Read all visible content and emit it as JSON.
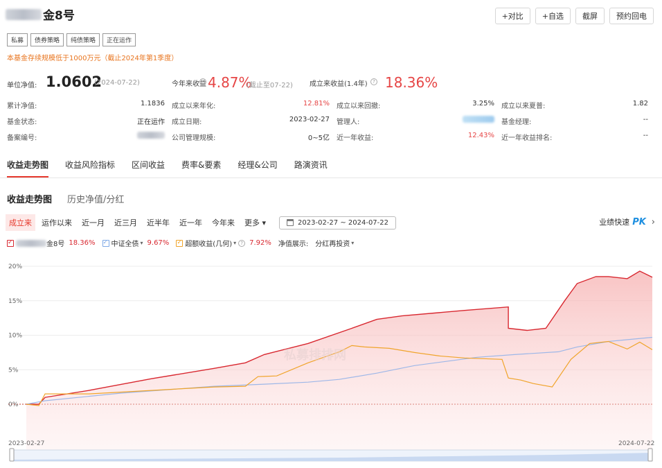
{
  "header": {
    "title_suffix": "金8号",
    "buttons": [
      "+对比",
      "+自选",
      "截屏",
      "预约回电"
    ]
  },
  "tags": [
    "私募",
    "债券策略",
    "纯债策略",
    "正在运作"
  ],
  "notice": "本基金存续规模低于1000万元（截止2024年第1季度）",
  "kpis": {
    "nav_label": "单位净值:",
    "nav_value": "1.0602",
    "nav_date": "(2024-07-22)",
    "ytd_label": "今年来收益",
    "ytd_value": "4.87%",
    "ytd_note": "(截止至07-22)",
    "since_label": "成立来收益(1.4年)",
    "since_value": "18.36%"
  },
  "info": [
    {
      "label": "累计净值:",
      "value": "1.1836",
      "red": false
    },
    {
      "label": "成立以来年化:",
      "value": "12.81%",
      "red": true
    },
    {
      "label": "成立以来回撤:",
      "value": "3.25%",
      "red": false
    },
    {
      "label": "成立以来夏普:",
      "value": "1.82",
      "red": false
    },
    {
      "label": "基金状态:",
      "value": "正在运作",
      "red": false
    },
    {
      "label": "成立日期:",
      "value": "2023-02-27",
      "red": false
    },
    {
      "label": "管理人:",
      "value": "",
      "red": false
    },
    {
      "label": "基金经理:",
      "value": "--",
      "red": false
    },
    {
      "label": "备案编号:",
      "value": "",
      "red": false
    },
    {
      "label": "公司管理规模:",
      "value": "0~5亿",
      "red": false
    },
    {
      "label": "近一年收益:",
      "value": "12.43%",
      "red": true
    },
    {
      "label": "近一年收益排名:",
      "value": "--",
      "red": false
    }
  ],
  "tabs": [
    "收益走势图",
    "收益风险指标",
    "区间收益",
    "费率&要素",
    "经理&公司",
    "路演资讯"
  ],
  "subtabs": [
    "收益走势图",
    "历史净值/分红"
  ],
  "periods": [
    "成立来",
    "运作以来",
    "近一月",
    "近三月",
    "近半年",
    "近一年",
    "今年来",
    "更多 ▾"
  ],
  "date_range": "2023-02-27 ~ 2024-07-22",
  "pk_label": "业绩快速",
  "pk_badge": "PK",
  "legend": {
    "fund_suffix": "金8号",
    "fund_value": "18.36%",
    "bench_name": "中证全债",
    "bench_value": "9.67%",
    "excess_name": "超额收益(几何)",
    "excess_value": "7.92%",
    "display_label": "净值展示:",
    "display_value": "分红再投资"
  },
  "colors": {
    "fund": "#d8272f",
    "bench": "#9db7e8",
    "excess": "#f0a42a",
    "accent": "#e6392d"
  },
  "chart_data": {
    "type": "line",
    "x_start": "2023-02-27",
    "x_end": "2024-07-22",
    "y_ticks": [
      "20%",
      "15%",
      "10%",
      "5%",
      "0%"
    ],
    "ylim": [
      0,
      20
    ],
    "series": [
      {
        "name": "金8号",
        "x": [
          0,
          0.02,
          0.03,
          0.1,
          0.2,
          0.3,
          0.35,
          0.38,
          0.45,
          0.52,
          0.56,
          0.6,
          0.7,
          0.77,
          0.77,
          0.8,
          0.83,
          0.86,
          0.88,
          0.91,
          0.93,
          0.96,
          0.98,
          1.0
        ],
        "values": [
          0,
          0,
          1.0,
          2.0,
          3.7,
          5.2,
          6.0,
          7.2,
          8.8,
          11.0,
          12.3,
          12.8,
          13.6,
          14.1,
          11.0,
          10.7,
          11.0,
          15.0,
          17.5,
          18.5,
          18.5,
          18.2,
          19.3,
          18.4
        ]
      },
      {
        "name": "中证全债",
        "x": [
          0,
          0.03,
          0.15,
          0.3,
          0.38,
          0.45,
          0.5,
          0.56,
          0.62,
          0.67,
          0.72,
          0.78,
          0.85,
          0.88,
          0.93,
          1.0
        ],
        "values": [
          0,
          0.5,
          1.6,
          2.6,
          2.9,
          3.2,
          3.6,
          4.5,
          5.6,
          6.2,
          6.8,
          7.2,
          7.6,
          8.3,
          9.1,
          9.7
        ]
      },
      {
        "name": "超额收益(几何)",
        "x": [
          0,
          0.02,
          0.03,
          0.1,
          0.2,
          0.3,
          0.35,
          0.37,
          0.4,
          0.45,
          0.5,
          0.52,
          0.54,
          0.58,
          0.62,
          0.66,
          0.7,
          0.76,
          0.77,
          0.79,
          0.81,
          0.84,
          0.87,
          0.9,
          0.93,
          0.96,
          0.98,
          1.0
        ],
        "values": [
          0,
          -0.2,
          1.5,
          1.5,
          2.0,
          2.5,
          2.6,
          4.0,
          4.1,
          6.0,
          7.6,
          8.5,
          8.3,
          8.1,
          7.5,
          7.0,
          6.7,
          6.5,
          3.8,
          3.5,
          3.0,
          2.5,
          6.5,
          8.8,
          9.1,
          8.0,
          9.0,
          7.9
        ]
      }
    ]
  }
}
